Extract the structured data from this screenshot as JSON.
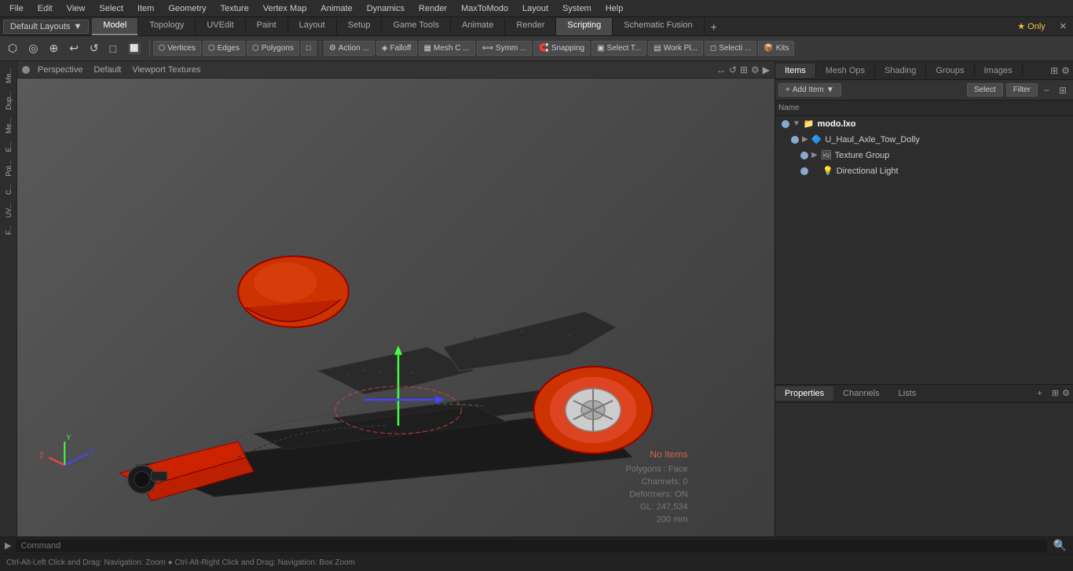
{
  "menuBar": {
    "items": [
      "File",
      "Edit",
      "View",
      "Select",
      "Item",
      "Geometry",
      "Texture",
      "Vertex Map",
      "Animate",
      "Dynamics",
      "Render",
      "MaxToModo",
      "Layout",
      "System",
      "Help"
    ]
  },
  "layoutBar": {
    "defaultLayouts": "Default Layouts",
    "tabs": [
      {
        "label": "Model",
        "active": false
      },
      {
        "label": "Topology",
        "active": false
      },
      {
        "label": "UVEdit",
        "active": false
      },
      {
        "label": "Paint",
        "active": false
      },
      {
        "label": "Layout",
        "active": false
      },
      {
        "label": "Setup",
        "active": false
      },
      {
        "label": "Game Tools",
        "active": false
      },
      {
        "label": "Animate",
        "active": false
      },
      {
        "label": "Render",
        "active": false
      },
      {
        "label": "Scripting",
        "active": true
      },
      {
        "label": "Schematic Fusion",
        "active": false
      }
    ],
    "plus": "+",
    "starOnly": "★ Only"
  },
  "toolbar": {
    "buttons": [
      {
        "label": "Vertices",
        "icon": "⬡"
      },
      {
        "label": "Edges",
        "icon": "⬡"
      },
      {
        "label": "Polygons",
        "icon": "⬡"
      },
      {
        "label": "",
        "icon": "□"
      },
      {
        "label": "Action ...",
        "icon": "⚙"
      },
      {
        "label": "Falloff",
        "icon": "◈"
      },
      {
        "label": "Mesh C ...",
        "icon": "▦"
      },
      {
        "label": "Symm ...",
        "icon": "⟺"
      },
      {
        "label": "Snapping",
        "icon": "🧲"
      },
      {
        "label": "Select T...",
        "icon": "▣"
      },
      {
        "label": "Work Pl...",
        "icon": "▤"
      },
      {
        "label": "Selecti ...",
        "icon": "◻"
      },
      {
        "label": "Kits",
        "icon": "📦"
      }
    ]
  },
  "viewport": {
    "dot": "●",
    "label1": "Perspective",
    "label2": "Default",
    "label3": "Viewport Textures",
    "controls": [
      "↔",
      "↺",
      "⊞",
      "⚙",
      "▶"
    ]
  },
  "leftSidebar": {
    "items": [
      "Me...",
      "Dup...",
      "Me...",
      "E...",
      "Pol...",
      "C...",
      "UV...",
      "F..."
    ]
  },
  "sceneStatus": {
    "noItems": "No Items",
    "polygons": "Polygons : Face",
    "channels": "Channels: 0",
    "deformers": "Deformers: ON",
    "gl": "GL: 247,534",
    "size": "200 mm"
  },
  "rightPanel": {
    "tabs": [
      {
        "label": "Items",
        "active": true
      },
      {
        "label": "Mesh Ops",
        "active": false
      },
      {
        "label": "Shading",
        "active": false
      },
      {
        "label": "Groups",
        "active": false
      },
      {
        "label": "Images",
        "active": false
      }
    ],
    "addItemLabel": "Add Item",
    "selectLabel": "Select",
    "filterLabel": "Filter",
    "columnName": "Name",
    "items": [
      {
        "indent": 1,
        "icon": "📁",
        "name": "modo.lxo",
        "bold": true,
        "visible": true,
        "hasArrow": true,
        "expanded": true
      },
      {
        "indent": 2,
        "icon": "🔷",
        "name": "U_Haul_Axle_Tow_Dolly",
        "bold": false,
        "visible": true,
        "hasArrow": true,
        "expanded": false
      },
      {
        "indent": 3,
        "icon": "🖼",
        "name": "Texture Group",
        "bold": false,
        "visible": true,
        "hasArrow": true,
        "expanded": false
      },
      {
        "indent": 3,
        "icon": "💡",
        "name": "Directional Light",
        "bold": false,
        "visible": true,
        "hasArrow": false,
        "expanded": false
      }
    ]
  },
  "propertiesPanel": {
    "tabs": [
      {
        "label": "Properties",
        "active": true
      },
      {
        "label": "Channels",
        "active": false
      },
      {
        "label": "Lists",
        "active": false
      }
    ]
  },
  "commandBar": {
    "placeholder": "Command",
    "arrowLabel": "▶"
  },
  "statusBar": {
    "hint": "Ctrl-Alt-Left Click and Drag: Navigation: Zoom ● Ctrl-Alt-Right Click and Drag: Navigation: Box Zoom"
  }
}
